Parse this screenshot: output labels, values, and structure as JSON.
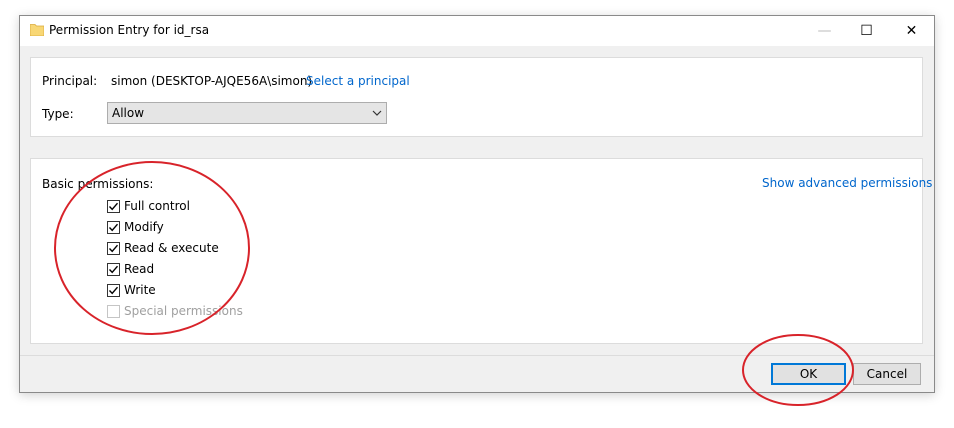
{
  "window": {
    "title": "Permission Entry for id_rsa",
    "minimize_glyph": "—",
    "maximize_glyph": "☐",
    "close_glyph": "✕"
  },
  "principal": {
    "label": "Principal:",
    "value": "simon (DESKTOP-AJQE56A\\simon)",
    "select_link": "Select a principal"
  },
  "type": {
    "label": "Type:",
    "selected": "Allow"
  },
  "permissions": {
    "label": "Basic permissions:",
    "advanced_link": "Show advanced permissions",
    "items": [
      {
        "label": "Full control",
        "checked": true,
        "enabled": true
      },
      {
        "label": "Modify",
        "checked": true,
        "enabled": true
      },
      {
        "label": "Read & execute",
        "checked": true,
        "enabled": true
      },
      {
        "label": "Read",
        "checked": true,
        "enabled": true
      },
      {
        "label": "Write",
        "checked": true,
        "enabled": true
      },
      {
        "label": "Special permissions",
        "checked": false,
        "enabled": false
      }
    ]
  },
  "buttons": {
    "ok": "OK",
    "cancel": "Cancel"
  },
  "colors": {
    "link": "#0066cc",
    "annotation": "#d8232a",
    "default_button_border": "#0078d7"
  }
}
